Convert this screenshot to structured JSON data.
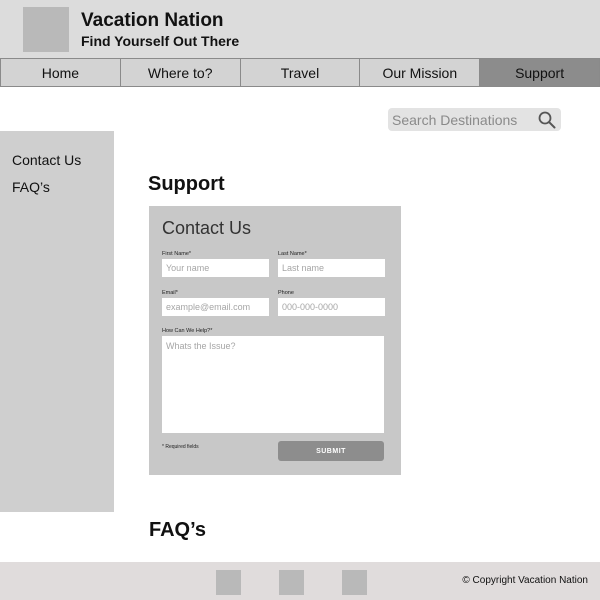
{
  "header": {
    "title": "Vacation Nation",
    "tagline": "Find Yourself Out There"
  },
  "nav": {
    "items": [
      {
        "label": "Home"
      },
      {
        "label": "Where to?"
      },
      {
        "label": "Travel"
      },
      {
        "label": "Our Mission"
      },
      {
        "label": "Support"
      }
    ],
    "active": "Support"
  },
  "search": {
    "placeholder": "Search Destinations",
    "icon": "search-icon"
  },
  "sidebar": {
    "items": [
      {
        "label": "Contact Us"
      },
      {
        "label": "FAQ’s"
      }
    ]
  },
  "main": {
    "title": "Support",
    "faq_title": "FAQ’s"
  },
  "contact_form": {
    "title": "Contact Us",
    "first_name": {
      "label": "First Name*",
      "placeholder": "Your name"
    },
    "last_name": {
      "label": "Last Name*",
      "placeholder": "Last name"
    },
    "email": {
      "label": "Email*",
      "placeholder": "example@email.com"
    },
    "phone": {
      "label": "Phone",
      "placeholder": "000-000-0000"
    },
    "message": {
      "label": "How Can We Help?*",
      "placeholder": "Whats the Issue?"
    },
    "required_note": "* Required fields",
    "submit_label": "SUBMIT"
  },
  "footer": {
    "copyright": "© Copyright Vacation Nation"
  },
  "colors": {
    "header_bg": "#dcdcdc",
    "nav_active": "#8c8c8c",
    "sidebar_bg": "#cfcfcf",
    "form_bg": "#c8c8c8",
    "footer_bg": "#e0dcdc"
  }
}
